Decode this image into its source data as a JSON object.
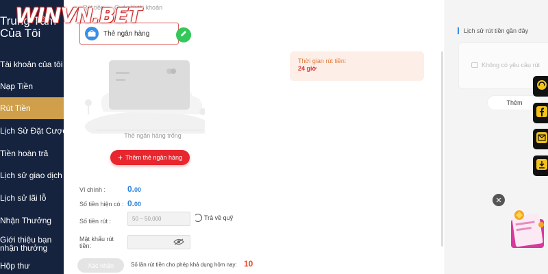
{
  "logo": {
    "text": "WINVN.BET"
  },
  "sidebar": {
    "title": "Trung Tâm Của Tôi",
    "items": [
      {
        "label": "Tài khoản của tôi"
      },
      {
        "label": "Nạp Tiền"
      },
      {
        "label": "Rút Tiền"
      },
      {
        "label": "Lịch Sử Đặt Cược"
      },
      {
        "label": "Tiền hoàn trả"
      },
      {
        "label": "Lịch sử giao dịch"
      },
      {
        "label": "Lịch sử lãi lỗ"
      },
      {
        "label": "Nhận Thưởng"
      },
      {
        "label": "Giới thiệu bạn nhận thưởng"
      },
      {
        "label": "Hộp thư"
      }
    ],
    "active_index": 2
  },
  "breadcrumb": {
    "first": "Rút tiền",
    "second": "Quản lý tài khoản"
  },
  "bank_tab": {
    "label": "Thẻ ngân hàng"
  },
  "card": {
    "empty_label": "Thẻ ngân hàng trống"
  },
  "add_bank_button": {
    "label": "Thêm thẻ ngân hàng"
  },
  "withdraw_time": {
    "label": "Thời gian rút tiền:",
    "value": "24 giờ"
  },
  "form": {
    "wallet_label": "Ví chính :",
    "wallet_value": "0.",
    "wallet_decimals": "00",
    "balance_label": "Số tiền hiện có :",
    "balance_value": "0.",
    "balance_decimals": "00",
    "amount_label": "Số tiền rút :",
    "amount_placeholder": "50 ~ 50,000",
    "refund_label": "Trả về quỹ",
    "password_label": "Mật khẩu rút tiền:",
    "confirm_label": "Xác nhận",
    "count_label": "Số lần rút tiền cho phép khả dụng hôm nay:",
    "count_value": "10"
  },
  "history": {
    "title": "Lịch sử rút tiền gần đây",
    "empty": "Không có yêu cầu rút",
    "more": "Thêm"
  },
  "colors": {
    "sidebar_bg": "#15233f",
    "active": "#cf9f4c",
    "accent_red": "#e8262e",
    "accent_blue": "#2b7fd6"
  }
}
